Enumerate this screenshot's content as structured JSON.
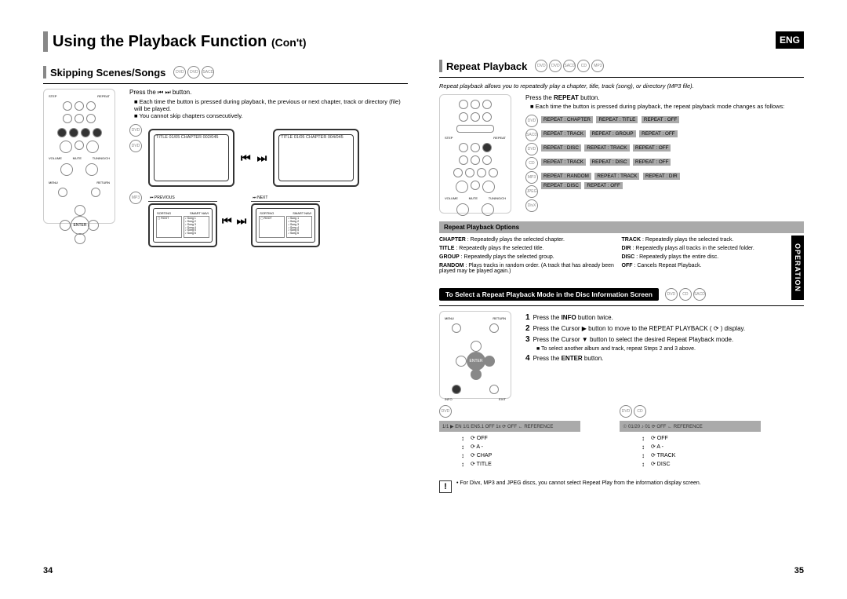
{
  "header": {
    "title_main": "Using the Playback Function",
    "title_cont": "(Con't)",
    "lang": "ENG",
    "side_tab": "OPERATION"
  },
  "left": {
    "section_title": "Skipping Scenes/Songs",
    "press_text": "Press the ⏮ ⏭ button.",
    "bullet1": "Each time the button is pressed during playback, the previous or next chapter, track or directory (file) will be played.",
    "bullet2": "You cannot skip chapters consecutively.",
    "tv1_caption": "TITLE 01/05 CHAPTER 002/045",
    "tv2_caption": "TITLE 01/05 CHAPTER 004/045",
    "mini_label_prev": "⏮ PREVIOUS",
    "mini_label_next": "⏭ NEXT",
    "mini_header_left": "SORTING",
    "mini_header_right": "SMART NAVI",
    "mini_col1": "▢ ROOT",
    "mini_col2": "♪ Song 1\n♪ Song 2\n♪ Song 3\n♪ Song 4\n♪ Song 5\n♪ Song 6",
    "page_num": "34"
  },
  "right": {
    "section_title": "Repeat Playback",
    "intro": "Repeat playback allows you to repeatedly play a chapter, title, track (song), or directory (MP3 file).",
    "press_text": "Press the REPEAT button.",
    "bullet": "Each time the button is pressed during playback, the repeat playback mode changes as follows:",
    "modes": {
      "dvd": [
        "REPEAT : CHAPTER",
        "REPEAT : TITLE",
        "REPEAT : OFF"
      ],
      "sacd": [
        "REPEAT : TRACK",
        "REPEAT : GROUP",
        "REPEAT : OFF"
      ],
      "dvda": [
        "REPEAT : DISC",
        "REPEAT : TRACK",
        "REPEAT : OFF"
      ],
      "cd": [
        "REPEAT : TRACK",
        "REPEAT : DISC",
        "REPEAT : OFF"
      ],
      "mp3a": [
        "REPEAT : RANDOM",
        "REPEAT : TRACK",
        "REPEAT : DIR"
      ],
      "mp3b": [
        "REPEAT : DISC",
        "REPEAT : OFF"
      ]
    },
    "options_header": "Repeat Playback Options",
    "options": [
      {
        "k": "CHAPTER",
        "v": ": Repeatedly plays the selected chapter."
      },
      {
        "k": "TRACK",
        "v": ": Repeatedly plays the selected track."
      },
      {
        "k": "TITLE",
        "v": ": Repeatedly plays the selected title."
      },
      {
        "k": "DIR",
        "v": ": Repeatedly plays all tracks in the selected folder."
      },
      {
        "k": "GROUP",
        "v": ": Repeatedly plays the selected group."
      },
      {
        "k": "DISC",
        "v": ": Repeatedly plays the entire disc."
      },
      {
        "k": "RANDOM",
        "v": ": Plays tracks in random order. (A track that has already been played may be played again.)"
      },
      {
        "k": "OFF",
        "v": ": Cancels Repeat Playback."
      }
    ],
    "select_header": "To Select a Repeat Playback Mode in the Disc Information Screen",
    "steps": {
      "s1": "Press the INFO button twice.",
      "s2": "Press the Cursor ▶ button to move to the REPEAT PLAYBACK ( ⟳ ) display.",
      "s3": "Press the Cursor ▼ button to select the desired Repeat Playback mode.",
      "s3_sub": "■ To select another album and track, repeat Steps 2 and 3 above.",
      "s4": "Press the ENTER button."
    },
    "diagA": {
      "bar": "1/1  ▶ EN 1/1  EN5.1  OFF  1x  ⟳ OFF ← REFERENCE",
      "items": [
        "⟳ OFF",
        "⟳ A -",
        "⟳ CHAP",
        "⟳ TITLE"
      ]
    },
    "diagB": {
      "bar": "☉ 01/20  ♪ 01  ⟳ OFF ← REFERENCE",
      "items": [
        "⟳ OFF",
        "⟳ A -",
        "⟳ TRACK",
        "⟳ DISC"
      ]
    },
    "note": "For Divx, MP3 and JPEG discs, you cannot select Repeat Play from the information display screen.",
    "page_num": "35"
  }
}
